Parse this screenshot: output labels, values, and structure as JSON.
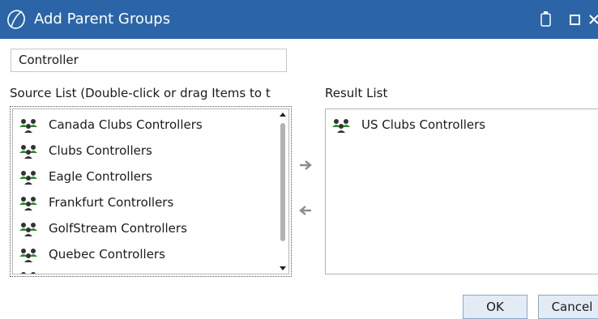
{
  "window": {
    "title": "Add Parent Groups",
    "app_icon": "sigma-logo-icon",
    "controls": [
      "restore-icon",
      "maximize-icon",
      "close-icon"
    ]
  },
  "filter": {
    "value": "Controller"
  },
  "source": {
    "label": "Source List (Double-click or drag Items to t",
    "items": [
      {
        "label": "Canada Clubs Controllers",
        "icon": "group-icon"
      },
      {
        "label": "Clubs Controllers",
        "icon": "group-icon"
      },
      {
        "label": "Eagle Controllers",
        "icon": "group-icon"
      },
      {
        "label": "Frankfurt Controllers",
        "icon": "group-icon"
      },
      {
        "label": "GolfStream Controllers",
        "icon": "group-icon"
      },
      {
        "label": "Quebec Controllers",
        "icon": "group-icon"
      }
    ]
  },
  "result": {
    "label": "Result List",
    "items": [
      {
        "label": "US Clubs Controllers",
        "icon": "group-icon"
      }
    ]
  },
  "actions": {
    "move_right_icon": "arrow-right-icon",
    "move_left_icon": "arrow-left-icon"
  },
  "buttons": {
    "ok": "OK",
    "cancel": "Cancel"
  },
  "colors": {
    "titlebar": "#2b65a8",
    "button_bg": "#e3ebf5",
    "button_border": "#8aa8cc"
  }
}
